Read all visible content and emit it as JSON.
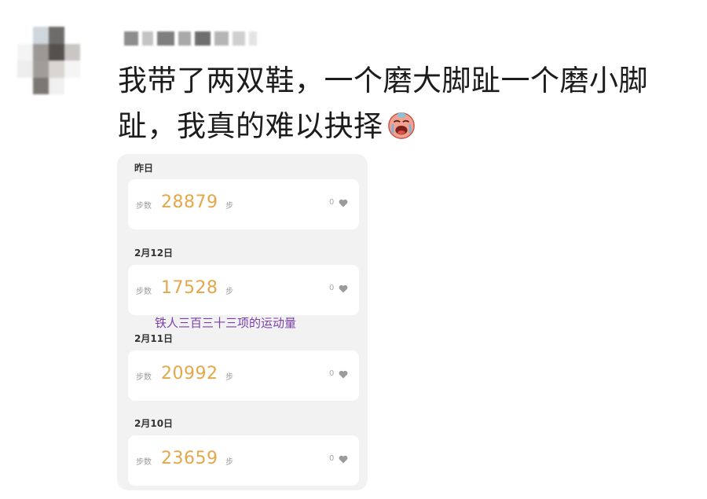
{
  "post": {
    "text": "我带了两双鞋，一个磨大脚趾一个磨小脚趾，我真的难以抉择",
    "emoji": "crying-face-emoji"
  },
  "step_screenshot": {
    "caption": "铁人三百三十三项的运动量",
    "step_label": "步数",
    "unit_label": "步",
    "days": [
      {
        "date": "昨日",
        "steps": "28879",
        "likes": "0"
      },
      {
        "date": "2月12日",
        "steps": "17528",
        "likes": "0"
      },
      {
        "date": "2月11日",
        "steps": "20992",
        "likes": "0"
      },
      {
        "date": "2月10日",
        "steps": "23659",
        "likes": "0"
      }
    ]
  },
  "colors": {
    "steps": "#e4a74a",
    "caption": "#7a3fa8",
    "panel_bg": "#f2f2f2"
  }
}
